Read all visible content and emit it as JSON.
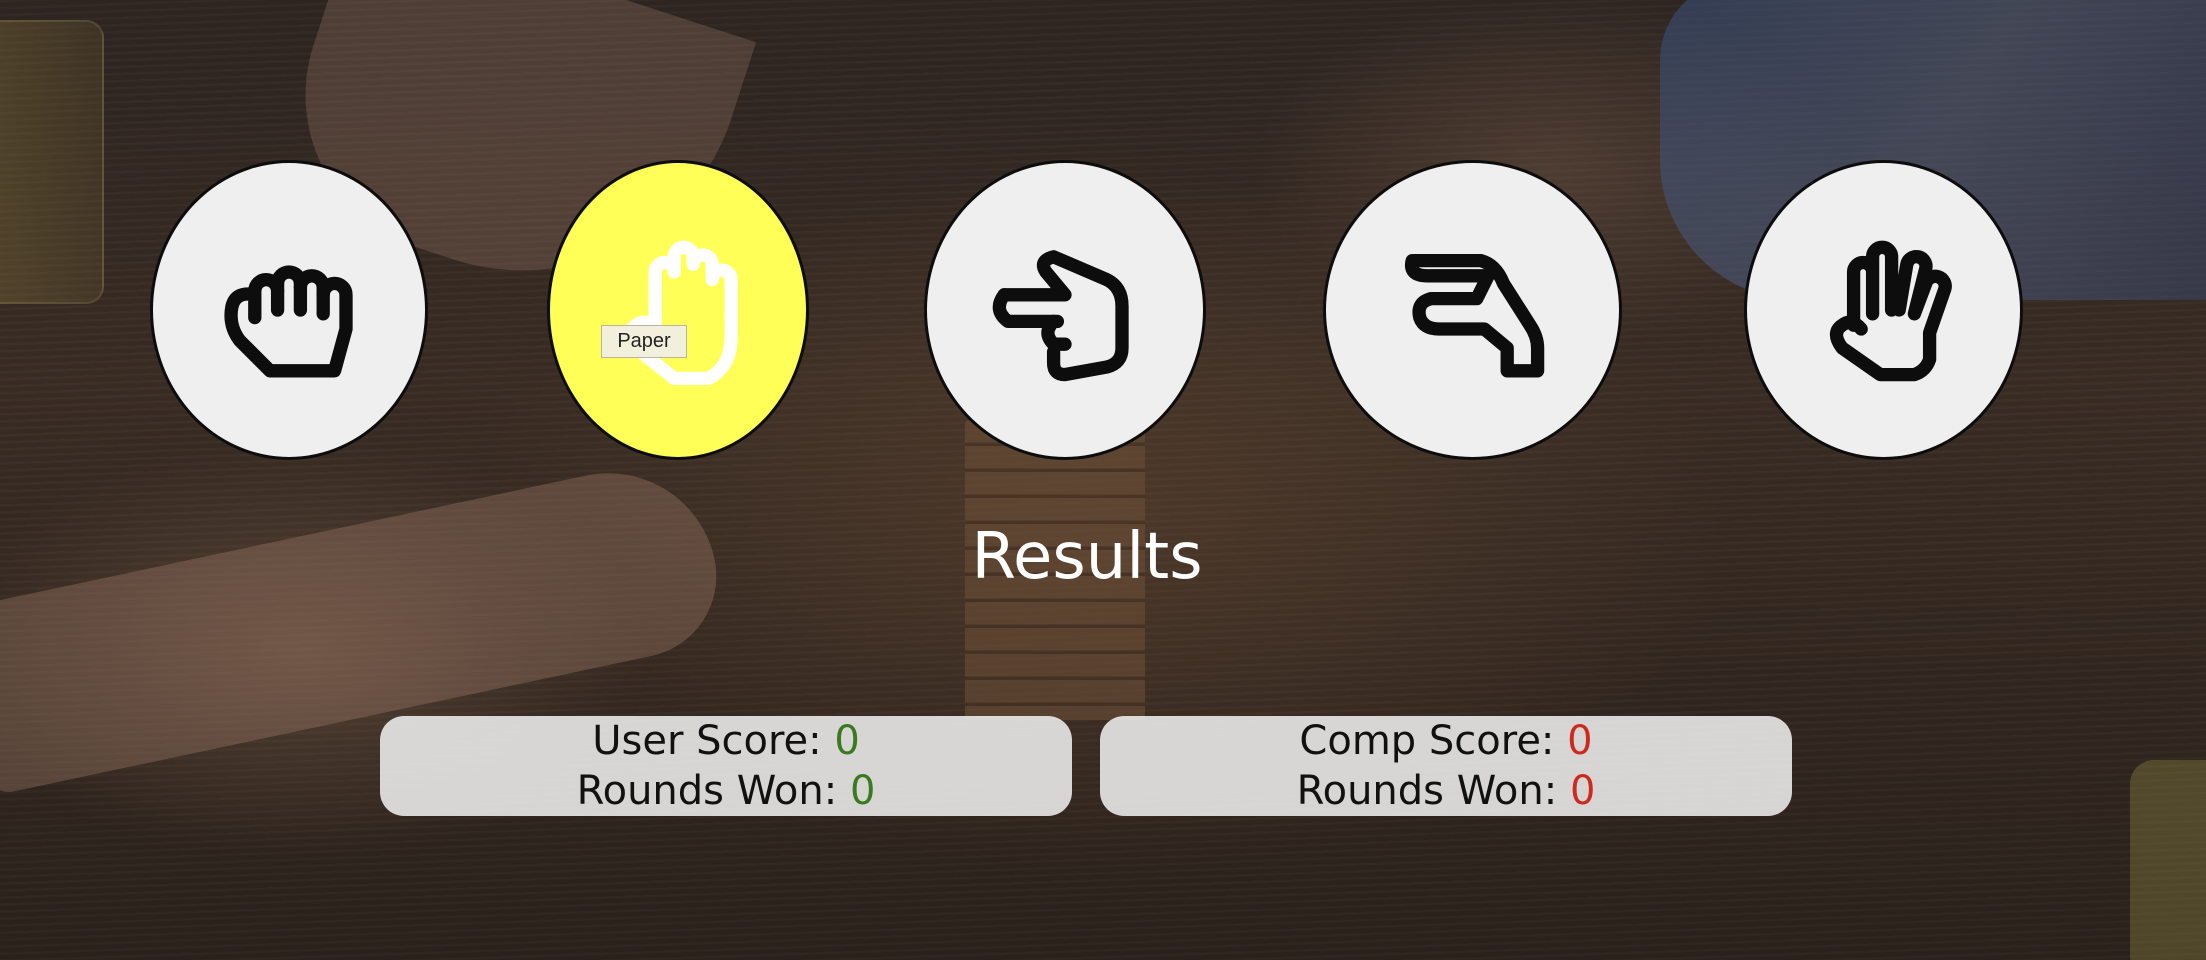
{
  "choices": [
    {
      "id": "rock",
      "icon": "rock-hand-icon",
      "selected": false
    },
    {
      "id": "paper",
      "icon": "paper-hand-icon",
      "selected": true
    },
    {
      "id": "scissors",
      "icon": "scissors-hand-icon",
      "selected": false
    },
    {
      "id": "lizard",
      "icon": "lizard-hand-icon",
      "selected": false
    },
    {
      "id": "spock",
      "icon": "spock-hand-icon",
      "selected": false
    }
  ],
  "tooltip": {
    "text": "Paper"
  },
  "results": {
    "title": "Results"
  },
  "user": {
    "score_label": "User Score: ",
    "score": "0",
    "rounds_label": "Rounds Won: ",
    "rounds": "0",
    "color": "#3a7a1e"
  },
  "comp": {
    "score_label": "Comp Score: ",
    "score": "0",
    "rounds_label": "Rounds Won: ",
    "rounds": "0",
    "color": "#cc2a1f"
  },
  "colors": {
    "selected": "#ffff57",
    "circle": "#efefef",
    "outline": "#0d0d0d"
  }
}
